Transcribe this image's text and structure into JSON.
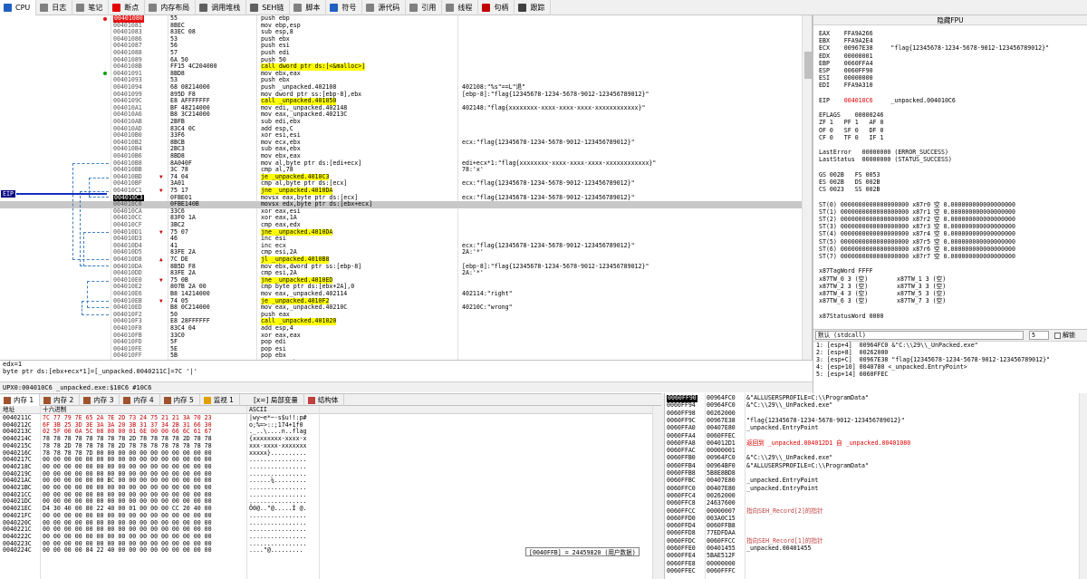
{
  "tabs": [
    {
      "label": "CPU",
      "color": "#2060c0",
      "active": true
    },
    {
      "label": "日志",
      "color": "#808080"
    },
    {
      "label": "笔记",
      "color": "#808080"
    },
    {
      "label": "断点",
      "color": "#e00000"
    },
    {
      "label": "内存布局",
      "color": "#808080"
    },
    {
      "label": "调用堆栈",
      "color": "#606060"
    },
    {
      "label": "SEH链",
      "color": "#606060"
    },
    {
      "label": "脚本",
      "color": "#808080"
    },
    {
      "label": "符号",
      "color": "#2060c0"
    },
    {
      "label": "源代码",
      "color": "#808080"
    },
    {
      "label": "引用",
      "color": "#808080"
    },
    {
      "label": "线程",
      "color": "#808080"
    },
    {
      "label": "句柄",
      "color": "#c00000"
    },
    {
      "label": "跟踪",
      "color": "#404040"
    }
  ],
  "disasm": [
    {
      "addr": "00401080",
      "bytes": "55",
      "instr": "push ebp",
      "cmt": "",
      "bp": "red",
      "addrstyle": "bp"
    },
    {
      "addr": "00401081",
      "bytes": "8BEC",
      "instr": "mov ebp,esp",
      "cmt": ""
    },
    {
      "addr": "00401083",
      "bytes": "83EC 08",
      "instr": "sub esp,8",
      "cmt": ""
    },
    {
      "addr": "00401086",
      "bytes": "53",
      "instr": "push ebx",
      "cmt": ""
    },
    {
      "addr": "00401087",
      "bytes": "56",
      "instr": "push esi",
      "cmt": ""
    },
    {
      "addr": "00401088",
      "bytes": "57",
      "instr": "push edi",
      "cmt": ""
    },
    {
      "addr": "00401089",
      "bytes": "6A 50",
      "instr": "push 50",
      "cmt": ""
    },
    {
      "addr": "0040108B",
      "bytes": "FF15 4C204000",
      "instr": "call dword ptr ds:[<&malloc>]",
      "cmt": "",
      "kind": "call"
    },
    {
      "addr": "00401091",
      "bytes": "8BD8",
      "instr": "mov ebx,eax",
      "cmt": "",
      "bp": "green"
    },
    {
      "addr": "00401093",
      "bytes": "53",
      "instr": "push ebx",
      "cmt": ""
    },
    {
      "addr": "00401094",
      "bytes": "68 08214000",
      "instr": "push _unpacked.402108",
      "cmt": "402108:\"%s\"==L\"退\""
    },
    {
      "addr": "00401099",
      "bytes": "895D F8",
      "instr": "mov dword ptr ss:[ebp-8],ebx",
      "cmt": "[ebp-8]:\"flag{12345678-1234-5678-9012-123456789012}\""
    },
    {
      "addr": "0040109C",
      "bytes": "E8 AFFFFFFF",
      "instr": "call _unpacked.401050",
      "cmt": "",
      "kind": "call"
    },
    {
      "addr": "004010A1",
      "bytes": "BF 48214000",
      "instr": "mov edi,_unpacked.402148",
      "cmt": "402148:\"flag{xxxxxxxx-xxxx-xxxx-xxxx-xxxxxxxxxxxx}\""
    },
    {
      "addr": "004010A6",
      "bytes": "B8 3C214000",
      "instr": "mov eax,_unpacked.40213C",
      "cmt": ""
    },
    {
      "addr": "004010AB",
      "bytes": "2BFB",
      "instr": "sub edi,ebx",
      "cmt": ""
    },
    {
      "addr": "004010AD",
      "bytes": "83C4 0C",
      "instr": "add esp,C",
      "cmt": ""
    },
    {
      "addr": "004010B0",
      "bytes": "33F6",
      "instr": "xor esi,esi",
      "cmt": ""
    },
    {
      "addr": "004010B2",
      "bytes": "8BCB",
      "instr": "mov ecx,ebx",
      "cmt": "ecx:\"flag{12345678-1234-5678-9012-123456789012}\""
    },
    {
      "addr": "004010B4",
      "bytes": "2BC3",
      "instr": "sub eax,ebx",
      "cmt": ""
    },
    {
      "addr": "004010B6",
      "bytes": "8BD8",
      "instr": "mov ebx,eax",
      "cmt": ""
    },
    {
      "addr": "004010B8",
      "bytes": "8A040F",
      "instr": "mov al,byte ptr ds:[edi+ecx]",
      "cmt": "edi+ecx*1:\"flag{xxxxxxxx-xxxx-xxxx-xxxx-xxxxxxxxxxxx}\""
    },
    {
      "addr": "004010BB",
      "bytes": "3C 78",
      "instr": "cmp al,78",
      "cmt": "78:'x'"
    },
    {
      "addr": "004010BD",
      "bytes": "74 04",
      "instr": "je _unpacked.4010C3",
      "cmt": "",
      "kind": "jmp",
      "arrow": "v"
    },
    {
      "addr": "004010BF",
      "bytes": "3A01",
      "instr": "cmp al,byte ptr ds:[ecx]",
      "cmt": "ecx:\"flag{12345678-1234-5678-9012-123456789012}\""
    },
    {
      "addr": "004010C1",
      "bytes": "75 17",
      "instr": "jne _unpacked.4010DA",
      "cmt": "",
      "kind": "jmp",
      "arrow": "v"
    },
    {
      "addr": "004010C3",
      "bytes": "0FBE01",
      "instr": "movsx eax,byte ptr ds:[ecx]",
      "cmt": "ecx:\"flag{12345678-1234-5678-9012-123456789012}\"",
      "addrstyle": "hl"
    },
    {
      "addr": "004010C6",
      "bytes": "0FBE140B",
      "instr": "movsx edx,byte ptr ds:[ebx+ecx]",
      "cmt": "",
      "cur": true
    },
    {
      "addr": "004010CA",
      "bytes": "33C6",
      "instr": "xor eax,esi",
      "cmt": ""
    },
    {
      "addr": "004010CC",
      "bytes": "83F0 1A",
      "instr": "xor eax,1A",
      "cmt": ""
    },
    {
      "addr": "004010CF",
      "bytes": "3BC2",
      "instr": "cmp eax,edx",
      "cmt": ""
    },
    {
      "addr": "004010D1",
      "bytes": "75 07",
      "instr": "jne _unpacked.4010DA",
      "cmt": "",
      "kind": "jmp",
      "arrow": "v"
    },
    {
      "addr": "004010D3",
      "bytes": "46",
      "instr": "inc esi",
      "cmt": ""
    },
    {
      "addr": "004010D4",
      "bytes": "41",
      "instr": "inc ecx",
      "cmt": "ecx:\"flag{12345678-1234-5678-9012-123456789012}\""
    },
    {
      "addr": "004010D5",
      "bytes": "83FE 2A",
      "instr": "cmp esi,2A",
      "cmt": "2A:'*'"
    },
    {
      "addr": "004010D8",
      "bytes": "7C DE",
      "instr": "jl _unpacked.4010B8",
      "cmt": "",
      "kind": "jmp",
      "arrow": "^"
    },
    {
      "addr": "004010DA",
      "bytes": "8B5D F8",
      "instr": "mov ebx,dword ptr ss:[ebp-8]",
      "cmt": "[ebp-8]:\"flag{12345678-1234-5678-9012-123456789012}\""
    },
    {
      "addr": "004010DD",
      "bytes": "83FE 2A",
      "instr": "cmp esi,2A",
      "cmt": "2A:'*'"
    },
    {
      "addr": "004010E0",
      "bytes": "75 0B",
      "instr": "jne _unpacked.4010ED",
      "cmt": "",
      "kind": "jmp",
      "arrow": "v"
    },
    {
      "addr": "004010E2",
      "bytes": "807B 2A 00",
      "instr": "cmp byte ptr ds:[ebx+2A],0",
      "cmt": ""
    },
    {
      "addr": "004010E6",
      "bytes": "B8 14214000",
      "instr": "mov eax,_unpacked.402114",
      "cmt": "402114:\"right\""
    },
    {
      "addr": "004010EB",
      "bytes": "74 05",
      "instr": "je _unpacked.4010F2",
      "cmt": "",
      "kind": "jmp",
      "arrow": "v"
    },
    {
      "addr": "004010ED",
      "bytes": "B8 0C214000",
      "instr": "mov eax,_unpacked.40210C",
      "cmt": "40210C:\"wrong\""
    },
    {
      "addr": "004010F2",
      "bytes": "50",
      "instr": "push eax",
      "cmt": ""
    },
    {
      "addr": "004010F3",
      "bytes": "E8 28FFFFFF",
      "instr": "call _unpacked.401020",
      "cmt": "",
      "kind": "call"
    },
    {
      "addr": "004010F8",
      "bytes": "83C4 04",
      "instr": "add esp,4",
      "cmt": ""
    },
    {
      "addr": "004010FB",
      "bytes": "33C0",
      "instr": "xor eax,eax",
      "cmt": ""
    },
    {
      "addr": "004010FD",
      "bytes": "5F",
      "instr": "pop edi",
      "cmt": ""
    },
    {
      "addr": "004010FE",
      "bytes": "5E",
      "instr": "pop esi",
      "cmt": ""
    },
    {
      "addr": "004010FF",
      "bytes": "5B",
      "instr": "pop ebx",
      "cmt": ""
    },
    {
      "addr": "00401100",
      "bytes": "8BE5",
      "instr": "mov esp,ebp",
      "cmt": ""
    },
    {
      "addr": "00401102",
      "bytes": "5D",
      "instr": "pop ebp",
      "cmt": ""
    },
    {
      "addr": "00401103",
      "bytes": "C3",
      "instr": "ret",
      "cmt": "",
      "kind": "ret"
    },
    {
      "addr": "00401104",
      "bytes": "3B0D 04304000",
      "instr": "cmp ecx,dword ptr ds:[403004]",
      "cmt": "ecx:\"flag{12345678-1234-5678-9012-123456789012}\""
    }
  ],
  "eip_label": "EIP",
  "info": {
    "line1": "edx=1",
    "line2": "byte ptr ds:[ebx+ecx*1]=[_unpacked.0040211C]=7C '|'",
    "line3": "",
    "upx": "UPX0:004010C6 _unpacked.exe:$10C6 #10C6"
  },
  "registers": {
    "title": "隐藏FPU",
    "lines": [
      {
        "t": "EAX    FFA9A266"
      },
      {
        "t": "EBX    FFA9A2E4",
        "u": true
      },
      {
        "t": "ECX    00967E38     \"flag{12345678-1234-5678-9012-123456789012}\"",
        "u": true
      },
      {
        "t": "EDX    00000001",
        "u": true
      },
      {
        "t": "EBP    0060FFA4"
      },
      {
        "t": "ESP    0060FF90"
      },
      {
        "t": "ESI    00000000"
      },
      {
        "t": "EDI    FFA9A310"
      },
      {
        "t": ""
      },
      {
        "t": "EIP    004010C6     _unpacked.004010C6",
        "red": "004010C6"
      },
      {
        "t": ""
      },
      {
        "t": "EFLAGS    00000246"
      },
      {
        "t": "ZF 1   PF 1   AF 0"
      },
      {
        "t": "OF 0   SF 0   DF 0"
      },
      {
        "t": "CF 0   TF 0   IF 1"
      },
      {
        "t": ""
      },
      {
        "t": "LastError   00000000 (ERROR_SUCCESS)"
      },
      {
        "t": "LastStatus  00000000 (STATUS_SUCCESS)"
      },
      {
        "t": ""
      },
      {
        "t": "GS 002B   FS 0053"
      },
      {
        "t": "ES 002B   DS 002B"
      },
      {
        "t": "CS 0023   SS 002B"
      },
      {
        "t": ""
      },
      {
        "t": "ST(0) 0000000000000000000 x87r0 空 0.000000000000000000"
      },
      {
        "t": "ST(1) 0000000000000000000 x87r1 空 0.000000000000000000"
      },
      {
        "t": "ST(2) 0000000000000000000 x87r2 空 0.000000000000000000"
      },
      {
        "t": "ST(3) 0000000000000000000 x87r3 空 0.000000000000000000"
      },
      {
        "t": "ST(4) 0000000000000000000 x87r4 空 0.000000000000000000"
      },
      {
        "t": "ST(5) 0000000000000000000 x87r5 空 0.000000000000000000"
      },
      {
        "t": "ST(6) 0000000000000000000 x87r6 空 0.000000000000000000"
      },
      {
        "t": "ST(7) 0000000000000000000 x87r7 空 0.000000000000000000"
      },
      {
        "t": ""
      },
      {
        "t": "x87TagWord FFFF"
      },
      {
        "t": "x87TW_0 3 (空)        x87TW_1 3 (空)"
      },
      {
        "t": "x87TW_2 3 (空)        x87TW_3 3 (空)"
      },
      {
        "t": "x87TW_4 3 (空)        x87TW_5 3 (空)"
      },
      {
        "t": "x87TW_6 3 (空)        x87TW_7 3 (空)"
      },
      {
        "t": ""
      },
      {
        "t": "x87StatusWord 0000"
      }
    ]
  },
  "callconv": {
    "select": "默认 (stdcall)",
    "num": "5",
    "unlock": "解锁",
    "lines": [
      "1: [esp+4]  00964FC0 &\"C:\\\\29\\\\_UnPacked.exe\"",
      "2: [esp+8]  00262000",
      "3: [esp+C]  00967E38 \"flag{12345678-1234-5678-9012-123456789012}\"",
      "4: [esp+10] 0040780 <_unpacked.EntryPoint>",
      "5: [esp+14] 0060FFEC"
    ]
  },
  "memtabs": [
    "内存 1",
    "内存 2",
    "内存 3",
    "内存 4",
    "内存 5",
    "监视 1",
    "[x=] 局部变量",
    "结构体"
  ],
  "hex": {
    "col_addr": "地址",
    "col_hex": "十六进制",
    "col_ascii": "ASCII",
    "rows": [
      {
        "a": "0040211C",
        "h": "7C 77 79 7E 65 2A 7E 2D 73 24 75 21 21 3A 70 23",
        "s": "|wy~e*~-s$u!!:p#",
        "hl": true
      },
      {
        "a": "0040212C",
        "h": "6F 3B 25 3D 3E 3A 3A 20 3B 31 37 34 2B 31 66 30",
        "s": "o;%=>::;174+1f0",
        "hl": true
      },
      {
        "a": "0040213C",
        "h": "02 5F 00 0A 5C 08 00 00 01 6E 00 00 66 6C 61 67",
        "s": "._..\\....n..flag",
        "hl": true
      },
      {
        "a": "0040214C",
        "h": "78 78 78 78 78 78 78 78 2D 78 78 78 78 2D 78 78",
        "s": "{xxxxxxxx-xxxx-x"
      },
      {
        "a": "0040215C",
        "h": "78 78 2D 78 78 78 78 2D 78 78 78 78 78 78 78 78",
        "s": "xxx-xxxx-xxxxxxx"
      },
      {
        "a": "0040216C",
        "h": "78 78 78 78 7D 00 00 00 00 00 00 00 00 00 00 00",
        "s": "xxxxx}.........."
      },
      {
        "a": "0040217C",
        "h": "00 00 00 00 00 00 00 00 00 00 00 00 00 00 00 00",
        "s": "................"
      },
      {
        "a": "0040218C",
        "h": "00 00 00 00 00 00 00 00 00 00 00 00 00 00 00 00",
        "s": "................"
      },
      {
        "a": "0040219C",
        "h": "00 00 00 00 00 00 00 00 00 00 00 00 00 00 00 00",
        "s": "................"
      },
      {
        "a": "004021AC",
        "h": "00 00 00 00 00 00 BC 00 00 00 00 00 00 00 00 00",
        "s": "......¼........."
      },
      {
        "a": "004021BC",
        "h": "00 00 00 00 00 00 00 00 00 00 00 00 00 00 00 00",
        "s": "................"
      },
      {
        "a": "004021CC",
        "h": "00 00 00 00 00 00 00 00 00 00 00 00 00 00 00 00",
        "s": "................"
      },
      {
        "a": "004021DC",
        "h": "00 00 00 00 00 00 00 00 00 00 00 00 00 00 00 00",
        "s": "................"
      },
      {
        "a": "004021EC",
        "h": "D4 30 40 00 80 22 40 00 01 00 00 00 CC 20 40 00",
        "s": "Ô0@..\"@.....Ì @."
      },
      {
        "a": "004021FC",
        "h": "00 00 00 00 00 00 00 00 00 00 00 00 00 00 00 00",
        "s": "................"
      },
      {
        "a": "0040220C",
        "h": "00 00 00 00 00 00 00 00 00 00 00 00 00 00 00 00",
        "s": "................"
      },
      {
        "a": "0040221C",
        "h": "00 00 00 00 00 00 00 00 00 00 00 00 00 00 00 00",
        "s": "................"
      },
      {
        "a": "0040222C",
        "h": "00 00 00 00 00 00 00 00 00 00 00 00 00 00 00 00",
        "s": "................"
      },
      {
        "a": "0040223C",
        "h": "00 00 00 00 00 00 00 00 00 00 00 00 00 00 00 00",
        "s": "................"
      },
      {
        "a": "0040224C",
        "h": "00 00 00 00 84 22 40 00 00 00 00 00 00 00 00 00",
        "s": "....\"@........."
      }
    ],
    "tooltip": "[0040FFB] = 24459820 (用户数据)"
  },
  "stack": [
    {
      "a": "0060FF90",
      "v": "00964FC0",
      "c": "&\"ALLUSERSPROFILE=C:\\\\ProgramData\"",
      "top": true
    },
    {
      "a": "0060FF94",
      "v": "00964FC0",
      "c": "&\"C:\\\\29\\\\_UnPacked.exe\""
    },
    {
      "a": "0060FF98",
      "v": "00262000",
      "c": ""
    },
    {
      "a": "0060FF9C",
      "v": "00967E38",
      "c": "\"flag{12345678-1234-5678-9012-123456789012}\""
    },
    {
      "a": "0060FFA0",
      "v": "00407E80",
      "c": "_unpacked.EntryPoint"
    },
    {
      "a": "0060FFA4",
      "v": "0060FFEC",
      "c": ""
    },
    {
      "a": "0060FFA8",
      "v": "004012D1",
      "c": "返回到 _unpacked.004012D1 自 _unpacked.00401080",
      "red": true
    },
    {
      "a": "0060FFAC",
      "v": "00000001",
      "c": ""
    },
    {
      "a": "0060FFB0",
      "v": "00964FC0",
      "c": "&\"C:\\\\29\\\\_UnPacked.exe\""
    },
    {
      "a": "0060FFB4",
      "v": "00964BF0",
      "c": "&\"ALLUSERSPROFILE=C:\\\\ProgramData\""
    },
    {
      "a": "0060FFB8",
      "v": "5B8E8BD8",
      "c": ""
    },
    {
      "a": "0060FFBC",
      "v": "00407E80",
      "c": "_unpacked.EntryPoint"
    },
    {
      "a": "0060FFC0",
      "v": "00407E80",
      "c": "_unpacked.EntryPoint"
    },
    {
      "a": "0060FFC4",
      "v": "00262000",
      "c": ""
    },
    {
      "a": "0060FFC8",
      "v": "24637600",
      "c": ""
    },
    {
      "a": "0060FFCC",
      "v": "00000007",
      "c": "指向SEH_Record[2]的指针",
      "blue": true
    },
    {
      "a": "0060FFD0",
      "v": "003A0C15",
      "c": ""
    },
    {
      "a": "0060FFD4",
      "v": "0060FFB8",
      "c": ""
    },
    {
      "a": "0060FFD8",
      "v": "77EDFDAA",
      "c": ""
    },
    {
      "a": "0060FFDC",
      "v": "0060FFCC",
      "c": "指向SEH_Record[1]的指针",
      "blue": true
    },
    {
      "a": "0060FFE0",
      "v": "00401455",
      "c": "_unpacked.00401455"
    },
    {
      "a": "0060FFE4",
      "v": "5BAE512F",
      "c": ""
    },
    {
      "a": "0060FFE8",
      "v": "00000000",
      "c": ""
    },
    {
      "a": "0060FFEC",
      "v": "0060FFFC",
      "c": ""
    }
  ]
}
